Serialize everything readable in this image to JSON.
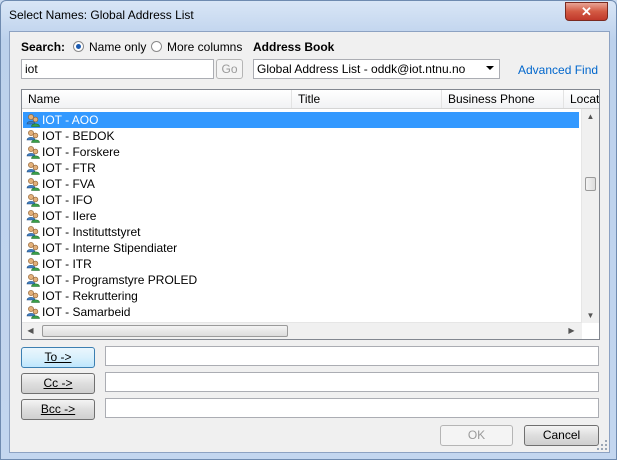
{
  "window": {
    "title": "Select Names: Global Address List",
    "close_glyph": "✕"
  },
  "search": {
    "label": "Search:",
    "radio_name_only": "Name only",
    "radio_more_columns": "More columns",
    "value": "iot",
    "go_label": "Go"
  },
  "address_book": {
    "label": "Address Book",
    "selected": "Global Address List - oddk@iot.ntnu.no",
    "advanced_find": "Advanced Find"
  },
  "table": {
    "columns": [
      "Name",
      "Title",
      "Business Phone",
      "Location"
    ],
    "rows": [
      "IOT - AOO",
      "IOT - BEDOK",
      "IOT - Forskere",
      "IOT - FTR",
      "IOT - FVA",
      "IOT - IFO",
      "IOT - IIere",
      "IOT - Instituttstyret",
      "IOT - Interne Stipendiater",
      "IOT - ITR",
      "IOT - Programstyre PROLED",
      "IOT - Rekruttering",
      "IOT - Samarbeid"
    ],
    "selected_index": 0
  },
  "recipients": {
    "to_label": "To ->",
    "cc_label": "Cc ->",
    "bcc_label": "Bcc ->",
    "to_value": "",
    "cc_value": "",
    "bcc_value": ""
  },
  "footer": {
    "ok_label": "OK",
    "cancel_label": "Cancel"
  },
  "colors": {
    "selection": "#3399ff",
    "link": "#0066cc"
  },
  "icons": {
    "row_icon": "distribution-list-icon",
    "close": "close-icon"
  }
}
